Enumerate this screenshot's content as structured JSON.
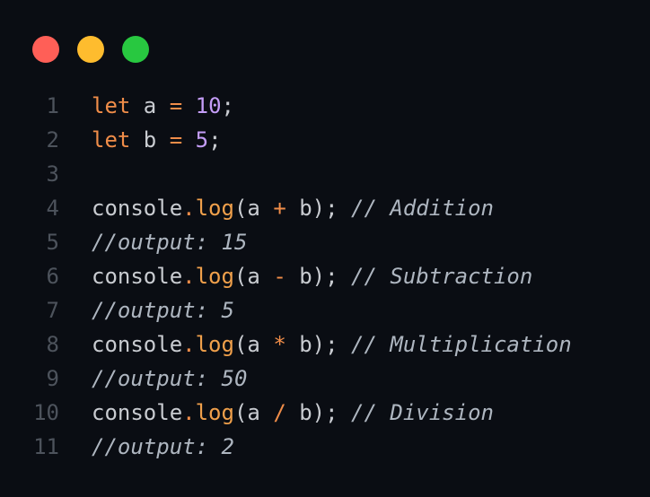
{
  "window": {
    "controls": [
      {
        "name": "close",
        "color": "#ff5f57"
      },
      {
        "name": "minimize",
        "color": "#febc2e"
      },
      {
        "name": "maximize",
        "color": "#28c840"
      }
    ]
  },
  "editor": {
    "lines": [
      {
        "num": "1",
        "tokens": [
          {
            "t": "kw",
            "v": "let"
          },
          {
            "t": "var",
            "v": " a "
          },
          {
            "t": "op",
            "v": "="
          },
          {
            "t": "var",
            "v": " "
          },
          {
            "t": "num",
            "v": "10"
          },
          {
            "t": "punc",
            "v": ";"
          }
        ]
      },
      {
        "num": "2",
        "tokens": [
          {
            "t": "kw",
            "v": "let"
          },
          {
            "t": "var",
            "v": " b "
          },
          {
            "t": "op",
            "v": "="
          },
          {
            "t": "var",
            "v": " "
          },
          {
            "t": "num",
            "v": "5"
          },
          {
            "t": "punc",
            "v": ";"
          }
        ]
      },
      {
        "num": "3",
        "tokens": []
      },
      {
        "num": "4",
        "tokens": [
          {
            "t": "obj",
            "v": "console"
          },
          {
            "t": "dot",
            "v": "."
          },
          {
            "t": "fn",
            "v": "log"
          },
          {
            "t": "punc",
            "v": "(a "
          },
          {
            "t": "op",
            "v": "+"
          },
          {
            "t": "punc",
            "v": " b); "
          },
          {
            "t": "comment",
            "v": "// Addition"
          }
        ]
      },
      {
        "num": "5",
        "tokens": [
          {
            "t": "comment",
            "v": "//output: 15"
          }
        ]
      },
      {
        "num": "6",
        "tokens": [
          {
            "t": "obj",
            "v": "console"
          },
          {
            "t": "dot",
            "v": "."
          },
          {
            "t": "fn",
            "v": "log"
          },
          {
            "t": "punc",
            "v": "(a "
          },
          {
            "t": "op",
            "v": "-"
          },
          {
            "t": "punc",
            "v": " b); "
          },
          {
            "t": "comment",
            "v": "// Subtraction"
          }
        ]
      },
      {
        "num": "7",
        "tokens": [
          {
            "t": "comment",
            "v": "//output: 5"
          }
        ]
      },
      {
        "num": "8",
        "tokens": [
          {
            "t": "obj",
            "v": "console"
          },
          {
            "t": "dot",
            "v": "."
          },
          {
            "t": "fn",
            "v": "log"
          },
          {
            "t": "punc",
            "v": "(a "
          },
          {
            "t": "op",
            "v": "*"
          },
          {
            "t": "punc",
            "v": " b); "
          },
          {
            "t": "comment",
            "v": "// Multiplication"
          }
        ]
      },
      {
        "num": "9",
        "tokens": [
          {
            "t": "comment",
            "v": "//output: 50"
          }
        ]
      },
      {
        "num": "10",
        "tokens": [
          {
            "t": "obj",
            "v": "console"
          },
          {
            "t": "dot",
            "v": "."
          },
          {
            "t": "fn",
            "v": "log"
          },
          {
            "t": "punc",
            "v": "(a "
          },
          {
            "t": "op",
            "v": "/"
          },
          {
            "t": "punc",
            "v": " b); "
          },
          {
            "t": "comment",
            "v": "// Division"
          }
        ]
      },
      {
        "num": "11",
        "tokens": [
          {
            "t": "comment",
            "v": "//output: 2"
          }
        ]
      }
    ]
  }
}
